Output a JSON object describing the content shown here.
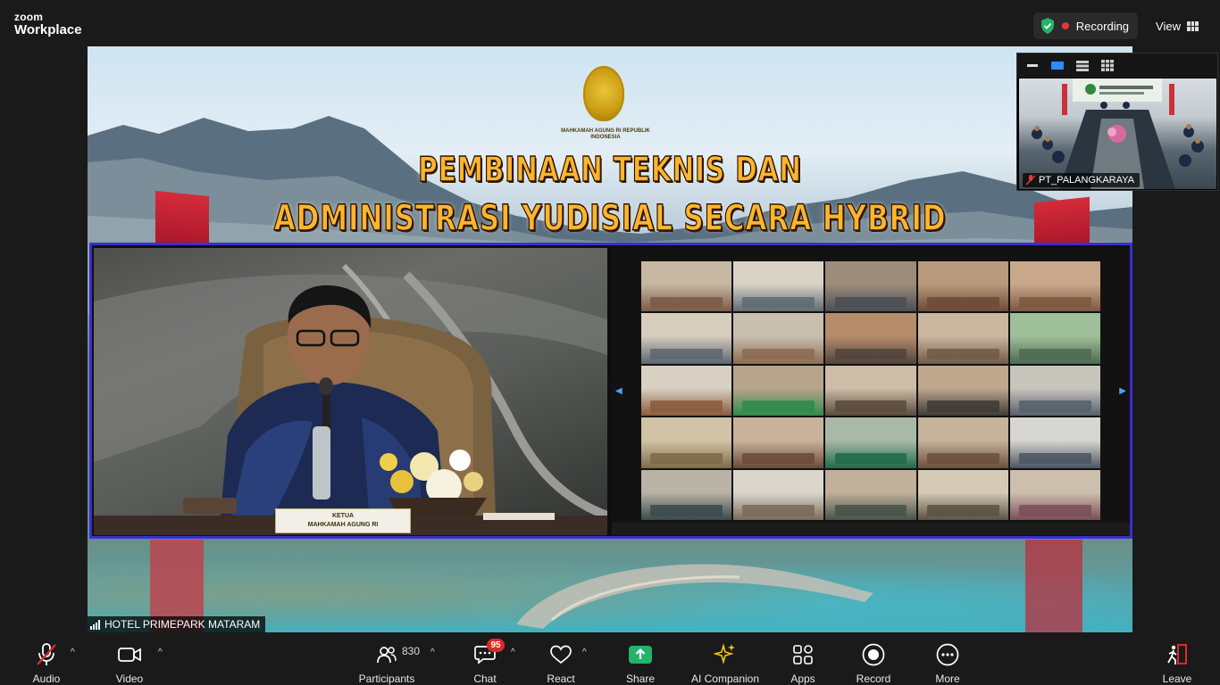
{
  "app": {
    "brand_top": "zoom",
    "brand_bottom": "Workplace"
  },
  "header": {
    "recording_label": "Recording",
    "view_label": "View"
  },
  "stage": {
    "headline_line1": "PEMBINAAN TEKNIS DAN",
    "headline_line2": "ADMINISTRASI YUDISIAL SECARA HYBRID",
    "logo_caption": "MAHKAMAH AGUNG RI REPUBLIK INDONESIA",
    "nameplate_line1": "KETUA",
    "nameplate_line2": "MAHKAMAH AGUNG RI",
    "active_speaker_name": "HOTEL PRIMEPARK MATARAM"
  },
  "self_view": {
    "name": "PT_PALANGKARAYA"
  },
  "toolbar": {
    "audio": "Audio",
    "video": "Video",
    "participants": "Participants",
    "participants_count": "830",
    "chat": "Chat",
    "chat_badge": "95",
    "react": "React",
    "share": "Share",
    "ai_companion": "AI Companion",
    "apps": "Apps",
    "record": "Record",
    "more": "More",
    "leave": "Leave"
  },
  "colors": {
    "accent_green": "#23b36a",
    "recording_red": "#e53935",
    "badge_red": "#e02828",
    "inset_border": "#3a2fd0",
    "ai_gold": "#f5c518"
  }
}
